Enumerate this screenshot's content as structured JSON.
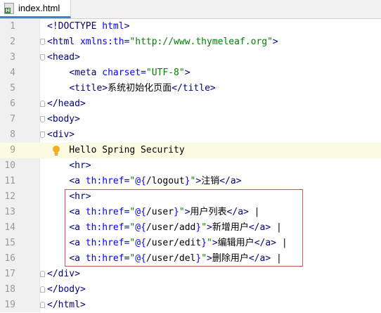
{
  "tab": {
    "filename": "index.html",
    "icon": "html-file-icon"
  },
  "colors": {
    "tag": "#000080",
    "attr": "#0000ff",
    "value": "#008000",
    "selection": "#d9534f",
    "current_line": "#fcfae1"
  },
  "current_line": 9,
  "lines": [
    {
      "n": "1",
      "tokens": [
        [
          "t",
          "<!DOCTYPE "
        ],
        [
          "a",
          "html"
        ],
        [
          "t",
          ">"
        ]
      ]
    },
    {
      "n": "2",
      "tokens": [
        [
          "t",
          "<html "
        ],
        [
          "a",
          "xmlns:th"
        ],
        [
          "a",
          "="
        ],
        [
          "v",
          "\"http://www.thymeleaf.org\""
        ],
        [
          "t",
          ">"
        ]
      ]
    },
    {
      "n": "3",
      "tokens": [
        [
          "t",
          "<head>"
        ]
      ]
    },
    {
      "n": "4",
      "tokens": [
        [
          "x",
          "    "
        ],
        [
          "t",
          "<meta "
        ],
        [
          "a",
          "charset"
        ],
        [
          "a",
          "="
        ],
        [
          "v",
          "\"UTF-8\""
        ],
        [
          "t",
          ">"
        ]
      ]
    },
    {
      "n": "5",
      "tokens": [
        [
          "x",
          "    "
        ],
        [
          "t",
          "<title>"
        ],
        [
          "x",
          "系统初始化页面"
        ],
        [
          "t",
          "</title>"
        ]
      ]
    },
    {
      "n": "6",
      "tokens": [
        [
          "t",
          "</head>"
        ]
      ]
    },
    {
      "n": "7",
      "tokens": [
        [
          "t",
          "<body>"
        ]
      ]
    },
    {
      "n": "8",
      "tokens": [
        [
          "t",
          "<div>"
        ]
      ]
    },
    {
      "n": "9",
      "tokens": [
        [
          "x",
          "    Hello Spring Security"
        ]
      ]
    },
    {
      "n": "10",
      "tokens": [
        [
          "x",
          "    "
        ],
        [
          "t",
          "<hr>"
        ]
      ]
    },
    {
      "n": "11",
      "tokens": [
        [
          "x",
          "    "
        ],
        [
          "t",
          "<a "
        ],
        [
          "a",
          "th:href"
        ],
        [
          "a",
          "="
        ],
        [
          "v",
          "\""
        ],
        [
          "e",
          "@{"
        ],
        [
          "x",
          "/logout"
        ],
        [
          "e",
          "}"
        ],
        [
          "v",
          "\""
        ],
        [
          "t",
          ">"
        ],
        [
          "x",
          "注销"
        ],
        [
          "t",
          "</a>"
        ]
      ]
    },
    {
      "n": "12",
      "tokens": [
        [
          "x",
          "    "
        ],
        [
          "t",
          "<hr>"
        ]
      ]
    },
    {
      "n": "13",
      "tokens": [
        [
          "x",
          "    "
        ],
        [
          "t",
          "<a "
        ],
        [
          "a",
          "th:href"
        ],
        [
          "a",
          "="
        ],
        [
          "v",
          "\""
        ],
        [
          "e",
          "@{"
        ],
        [
          "x",
          "/user"
        ],
        [
          "e",
          "}"
        ],
        [
          "v",
          "\""
        ],
        [
          "t",
          ">"
        ],
        [
          "x",
          "用户列表"
        ],
        [
          "t",
          "</a>"
        ],
        [
          "x",
          " |"
        ]
      ]
    },
    {
      "n": "14",
      "tokens": [
        [
          "x",
          "    "
        ],
        [
          "t",
          "<a "
        ],
        [
          "a",
          "th:href"
        ],
        [
          "a",
          "="
        ],
        [
          "v",
          "\""
        ],
        [
          "e",
          "@{"
        ],
        [
          "x",
          "/user/add"
        ],
        [
          "e",
          "}"
        ],
        [
          "v",
          "\""
        ],
        [
          "t",
          ">"
        ],
        [
          "x",
          "新增用户"
        ],
        [
          "t",
          "</a>"
        ],
        [
          "x",
          " |"
        ]
      ]
    },
    {
      "n": "15",
      "tokens": [
        [
          "x",
          "    "
        ],
        [
          "t",
          "<a "
        ],
        [
          "a",
          "th:href"
        ],
        [
          "a",
          "="
        ],
        [
          "v",
          "\""
        ],
        [
          "e",
          "@{"
        ],
        [
          "x",
          "/user/edit"
        ],
        [
          "e",
          "}"
        ],
        [
          "v",
          "\""
        ],
        [
          "t",
          ">"
        ],
        [
          "x",
          "编辑用户"
        ],
        [
          "t",
          "</a>"
        ],
        [
          "x",
          " |"
        ]
      ]
    },
    {
      "n": "16",
      "tokens": [
        [
          "x",
          "    "
        ],
        [
          "t",
          "<a "
        ],
        [
          "a",
          "th:href"
        ],
        [
          "a",
          "="
        ],
        [
          "v",
          "\""
        ],
        [
          "e",
          "@{"
        ],
        [
          "x",
          "/user/del"
        ],
        [
          "e",
          "}"
        ],
        [
          "v",
          "\""
        ],
        [
          "t",
          ">"
        ],
        [
          "x",
          "删除用户"
        ],
        [
          "t",
          "</a>"
        ],
        [
          "x",
          " |"
        ]
      ]
    },
    {
      "n": "17",
      "tokens": [
        [
          "t",
          "</div>"
        ]
      ]
    },
    {
      "n": "18",
      "tokens": [
        [
          "t",
          "</body>"
        ]
      ]
    },
    {
      "n": "19",
      "tokens": [
        [
          "t",
          "</html>"
        ]
      ]
    }
  ],
  "folds": [
    {
      "line": 2,
      "kind": "open"
    },
    {
      "line": 3,
      "kind": "open"
    },
    {
      "line": 6,
      "kind": "close"
    },
    {
      "line": 7,
      "kind": "open"
    },
    {
      "line": 8,
      "kind": "open"
    },
    {
      "line": 17,
      "kind": "close"
    },
    {
      "line": 18,
      "kind": "close"
    },
    {
      "line": 19,
      "kind": "close"
    }
  ]
}
